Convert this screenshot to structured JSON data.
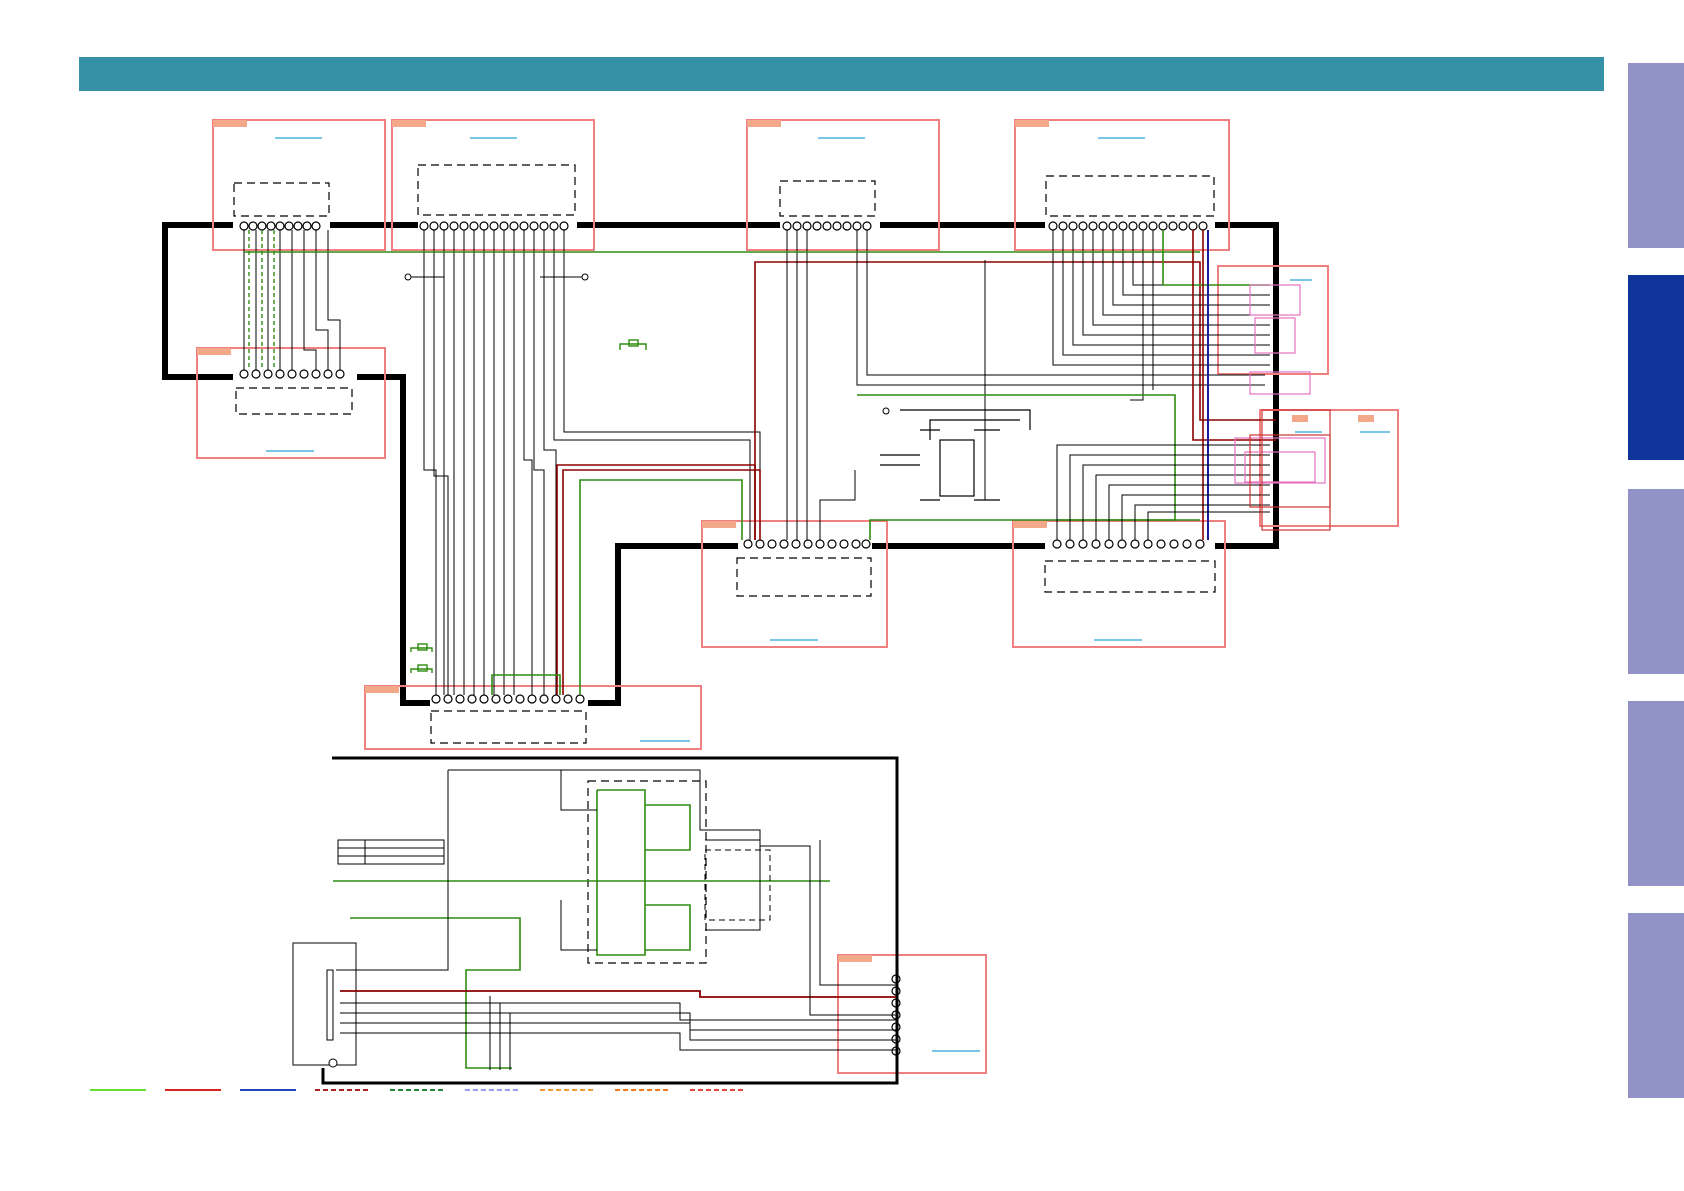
{
  "header": {
    "title": ""
  },
  "colors": {
    "header": "#3591a6",
    "tab_inactive": "#9193c6",
    "tab_active": "#10359a",
    "board_outline": "#f08080",
    "board_tag": "#f4a88a",
    "link": "#2aa3d8",
    "wire_green": "#2e8b10",
    "wire_red": "#8b0000",
    "wire_blue": "#1a1a9a"
  },
  "side_tabs": [
    {
      "name": "tab-1",
      "active": false
    },
    {
      "name": "tab-2",
      "active": true
    },
    {
      "name": "tab-3",
      "active": false
    },
    {
      "name": "tab-4",
      "active": false
    },
    {
      "name": "tab-5",
      "active": false
    }
  ],
  "legend": [
    {
      "color": "#66dd33",
      "style": "solid"
    },
    {
      "color": "#dd2222",
      "style": "solid"
    },
    {
      "color": "#2244bb",
      "style": "solid"
    },
    {
      "color": "#aa2222",
      "style": "dashed"
    },
    {
      "color": "#228833",
      "style": "dashed"
    },
    {
      "color": "#9999ee",
      "style": "dashed"
    },
    {
      "color": "#ee9933",
      "style": "dashed"
    },
    {
      "color": "#ee7722",
      "style": "dashed"
    },
    {
      "color": "#ee4444",
      "style": "dashed"
    }
  ]
}
